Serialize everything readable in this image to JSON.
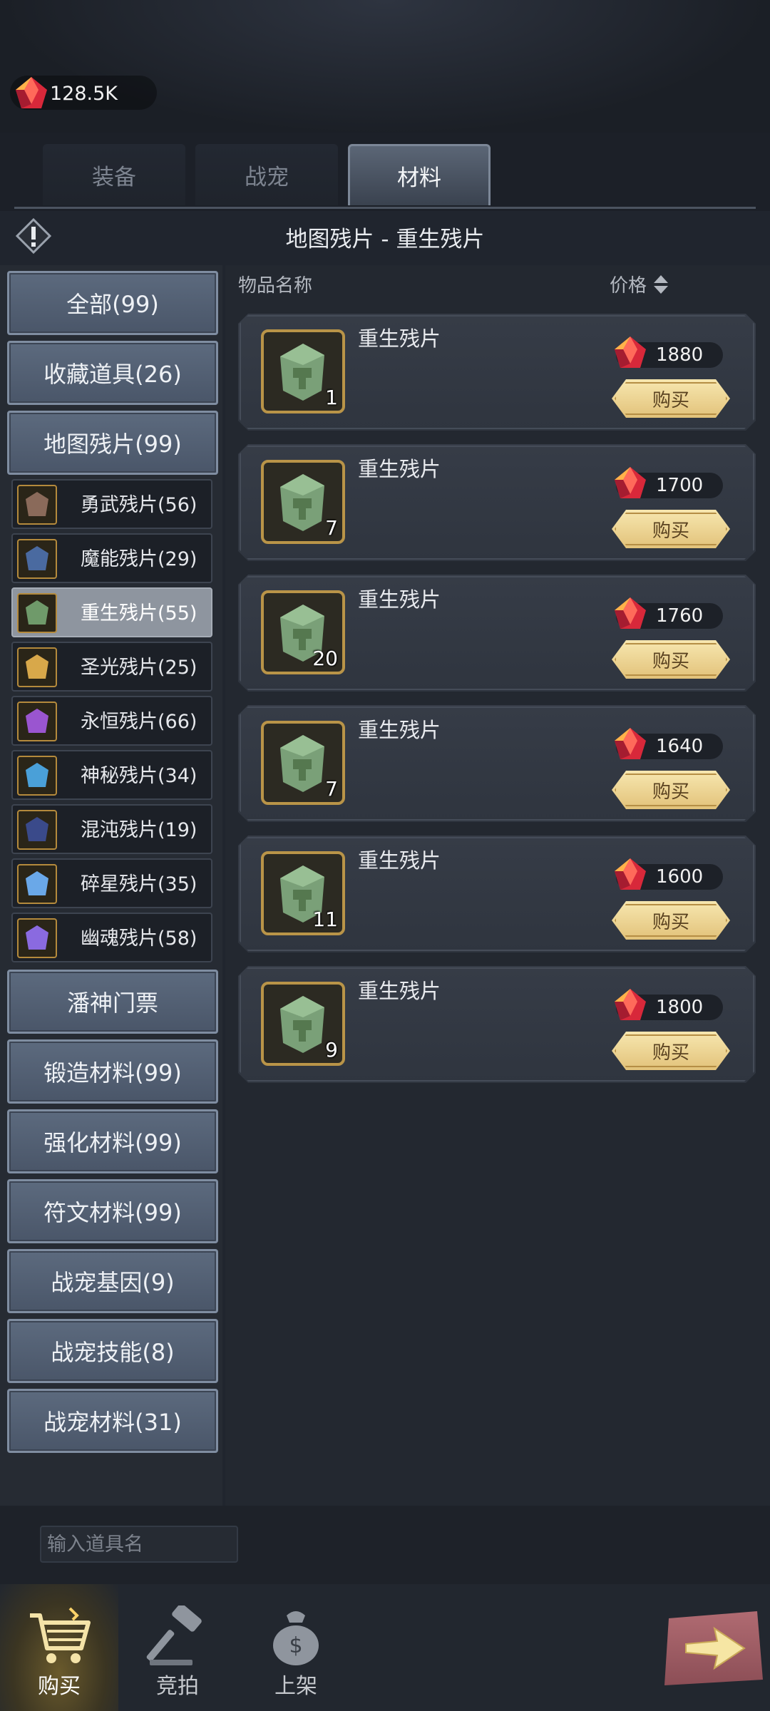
{
  "currency": {
    "amount": "128.5K",
    "icon": "ruby-gem-icon"
  },
  "tabs": [
    {
      "label": "装备",
      "active": false
    },
    {
      "label": "战宠",
      "active": false
    },
    {
      "label": "材料",
      "active": true
    }
  ],
  "breadcrumb": "地图残片 - 重生残片",
  "columns": {
    "name": "物品名称",
    "price": "价格"
  },
  "sidebar": {
    "top_categories": [
      {
        "label": "全部(99)"
      },
      {
        "label": "收藏道具(26)"
      },
      {
        "label": "地图残片(99)"
      }
    ],
    "sub_categories": [
      {
        "label": "勇武残片(56)",
        "color": "#8a6a5a",
        "active": false
      },
      {
        "label": "魔能残片(29)",
        "color": "#4a6aa0",
        "active": false
      },
      {
        "label": "重生残片(55)",
        "color": "#6f9a6a",
        "active": true
      },
      {
        "label": "圣光残片(25)",
        "color": "#d8a84a",
        "active": false
      },
      {
        "label": "永恒残片(66)",
        "color": "#9a55d0",
        "active": false
      },
      {
        "label": "神秘残片(34)",
        "color": "#4aa0d8",
        "active": false
      },
      {
        "label": "混沌残片(19)",
        "color": "#3a4a8a",
        "active": false
      },
      {
        "label": "碎星残片(35)",
        "color": "#6aa8e8",
        "active": false
      },
      {
        "label": "幽魂残片(58)",
        "color": "#8a6ae0",
        "active": false
      }
    ],
    "bottom_categories": [
      {
        "label": "潘神门票"
      },
      {
        "label": "锻造材料(99)"
      },
      {
        "label": "强化材料(99)"
      },
      {
        "label": "符文材料(99)"
      },
      {
        "label": "战宠基因(9)"
      },
      {
        "label": "战宠技能(8)"
      },
      {
        "label": "战宠材料(31)"
      }
    ]
  },
  "items": [
    {
      "name": "重生残片",
      "qty": "1",
      "price": "1880",
      "buy_label": "购买"
    },
    {
      "name": "重生残片",
      "qty": "7",
      "price": "1700",
      "buy_label": "购买"
    },
    {
      "name": "重生残片",
      "qty": "20",
      "price": "1760",
      "buy_label": "购买"
    },
    {
      "name": "重生残片",
      "qty": "7",
      "price": "1640",
      "buy_label": "购买"
    },
    {
      "name": "重生残片",
      "qty": "11",
      "price": "1600",
      "buy_label": "购买"
    },
    {
      "name": "重生残片",
      "qty": "9",
      "price": "1800",
      "buy_label": "购买"
    }
  ],
  "search": {
    "placeholder": "输入道具名"
  },
  "bottom_nav": [
    {
      "label": "购买",
      "icon": "shopping-cart-icon",
      "active": true
    },
    {
      "label": "竞拍",
      "icon": "auction-hammer-icon",
      "active": false
    },
    {
      "label": "上架",
      "icon": "money-bag-icon",
      "active": false
    }
  ],
  "colors": {
    "accent_gold": "#e2c27a",
    "tab_active": "#5b6676",
    "category_blue": "#5c6a7e"
  }
}
